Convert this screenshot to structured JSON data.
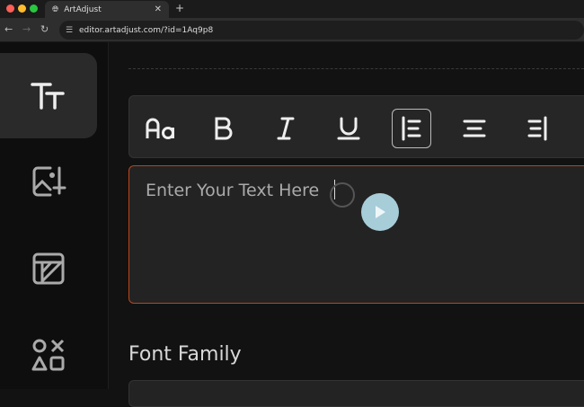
{
  "browser": {
    "tab_title": "ArtAdjust",
    "url": "editor.artadjust.com/?id=1Aq9p8"
  },
  "sidebar": {
    "items": [
      {
        "name": "text",
        "active": true
      },
      {
        "name": "add-image"
      },
      {
        "name": "frame"
      },
      {
        "name": "shapes"
      }
    ]
  },
  "toolbar": {
    "buttons": [
      "font-size",
      "bold",
      "italic",
      "underline",
      "align-left",
      "align-center",
      "align-right"
    ],
    "selected": "align-left"
  },
  "editor": {
    "placeholder": "Enter Your Text Here"
  },
  "font_family": {
    "label": "Font Family"
  },
  "colors": {
    "accent_border": "#b8461c",
    "play_button": "#a7cdd9"
  }
}
